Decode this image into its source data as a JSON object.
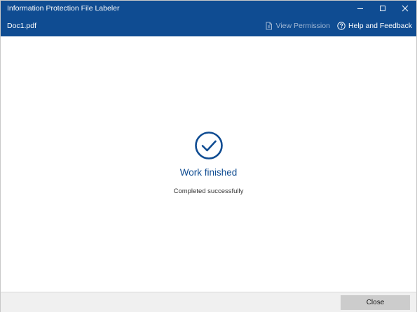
{
  "window": {
    "title": "Information Protection File Labeler",
    "controls": [
      "minimize-icon",
      "maximize-icon",
      "close-icon"
    ]
  },
  "toolbar": {
    "filename": "Doc1.pdf",
    "view_permission_label": "View Permission",
    "help_label": "Help and Feedback"
  },
  "status": {
    "icon": "checkmark-circle-icon",
    "title": "Work finished",
    "message": "Completed successfully"
  },
  "footer": {
    "close_label": "Close"
  },
  "colors": {
    "accent": "#0f4c92",
    "footer_bg": "#f0f0f0",
    "button_bg": "#cccccc"
  }
}
